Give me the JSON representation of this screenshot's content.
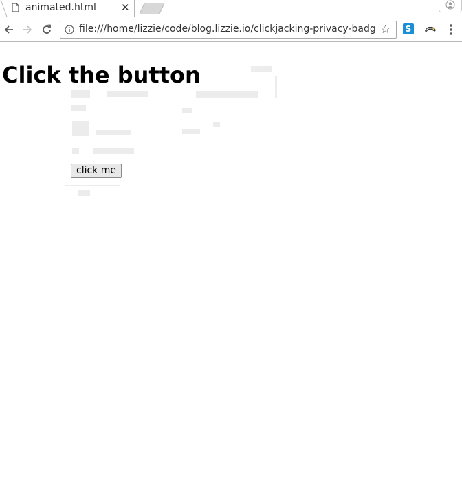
{
  "tab": {
    "title": "animated.html",
    "close_glyph": "✕",
    "icon": "document-icon"
  },
  "toolbar": {
    "url": "file:///home/lizzie/code/blog.lizzie.io/clickjacking-privacy-badger/a...",
    "back_icon": "back-arrow-icon",
    "forward_icon": "forward-arrow-icon",
    "reload_icon": "reload-icon",
    "info_icon": "info-icon",
    "star_glyph": "☆",
    "extension_s_label": "S",
    "extension_badger_icon": "badger-icon",
    "menu_icon": "kebab-menu-icon",
    "profile_icon": "profile-icon"
  },
  "page": {
    "heading": "Click the button",
    "button_label": "click me"
  }
}
